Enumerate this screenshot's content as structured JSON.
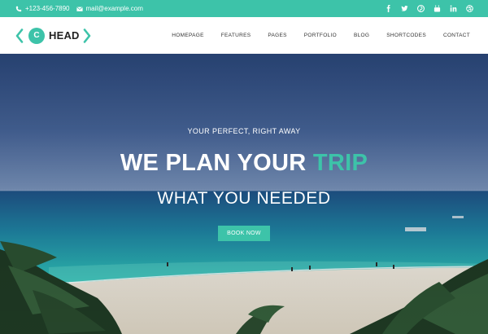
{
  "topbar": {
    "phone": "+123-456-7890",
    "email": "mail@example.com",
    "phone_icon": "phone-icon",
    "email_icon": "envelope-icon",
    "social": [
      "facebook-icon",
      "twitter-icon",
      "pinterest-icon",
      "youtube-icon",
      "linkedin-icon",
      "dribbble-icon"
    ],
    "background": "#3dc3a9"
  },
  "logo": {
    "letter": "C",
    "text": "HEAD"
  },
  "nav": {
    "items": [
      "HOMEPAGE",
      "FEATURES",
      "PAGES",
      "PORTFOLIO",
      "BLOG",
      "SHORTCODES",
      "CONTACT"
    ]
  },
  "hero": {
    "kicker": "YOUR PERFECT, RIGHT AWAY",
    "headline_main": "WE PLAN YOUR ",
    "headline_accent": "TRIP",
    "subline": "WHAT YOU NEEDED",
    "cta_label": "BOOK NOW"
  },
  "colors": {
    "accent": "#3dc3a9",
    "text_dark": "#222222"
  }
}
